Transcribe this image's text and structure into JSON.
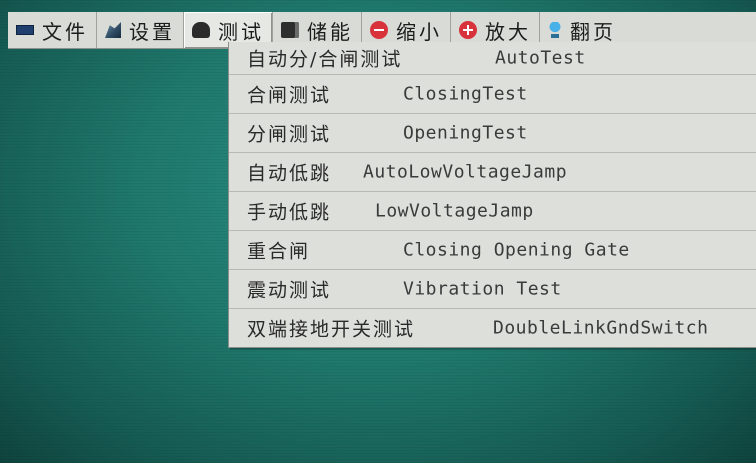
{
  "menubar": {
    "items": [
      {
        "label": "文件",
        "icon": "monitor-icon"
      },
      {
        "label": "设置",
        "icon": "wrench-icon"
      },
      {
        "label": "测试",
        "icon": "test-icon"
      },
      {
        "label": "储能",
        "icon": "storage-icon"
      },
      {
        "label": "缩小",
        "icon": "zoom-out-icon"
      },
      {
        "label": "放大",
        "icon": "zoom-in-icon"
      },
      {
        "label": "翻页",
        "icon": "page-icon"
      }
    ],
    "active": "测试"
  },
  "test_menu": {
    "items": [
      {
        "cn": "自动分/合闸测试",
        "en": "AutoTest"
      },
      {
        "cn": "合闸测试",
        "en": "ClosingTest"
      },
      {
        "cn": "分闸测试",
        "en": "OpeningTest"
      },
      {
        "cn": "自动低跳",
        "en": "AutoLowVoltageJamp"
      },
      {
        "cn": "手动低跳",
        "en": "LowVoltageJamp"
      },
      {
        "cn": "重合闸",
        "en": "Closing Opening Gate"
      },
      {
        "cn": "震动测试",
        "en": "Vibration Test"
      },
      {
        "cn": "双端接地开关测试",
        "en": "DoubleLinkGndSwitch"
      }
    ]
  },
  "colors": {
    "screen_background": "#1f786c",
    "menu_background": "#d9dbd6"
  }
}
